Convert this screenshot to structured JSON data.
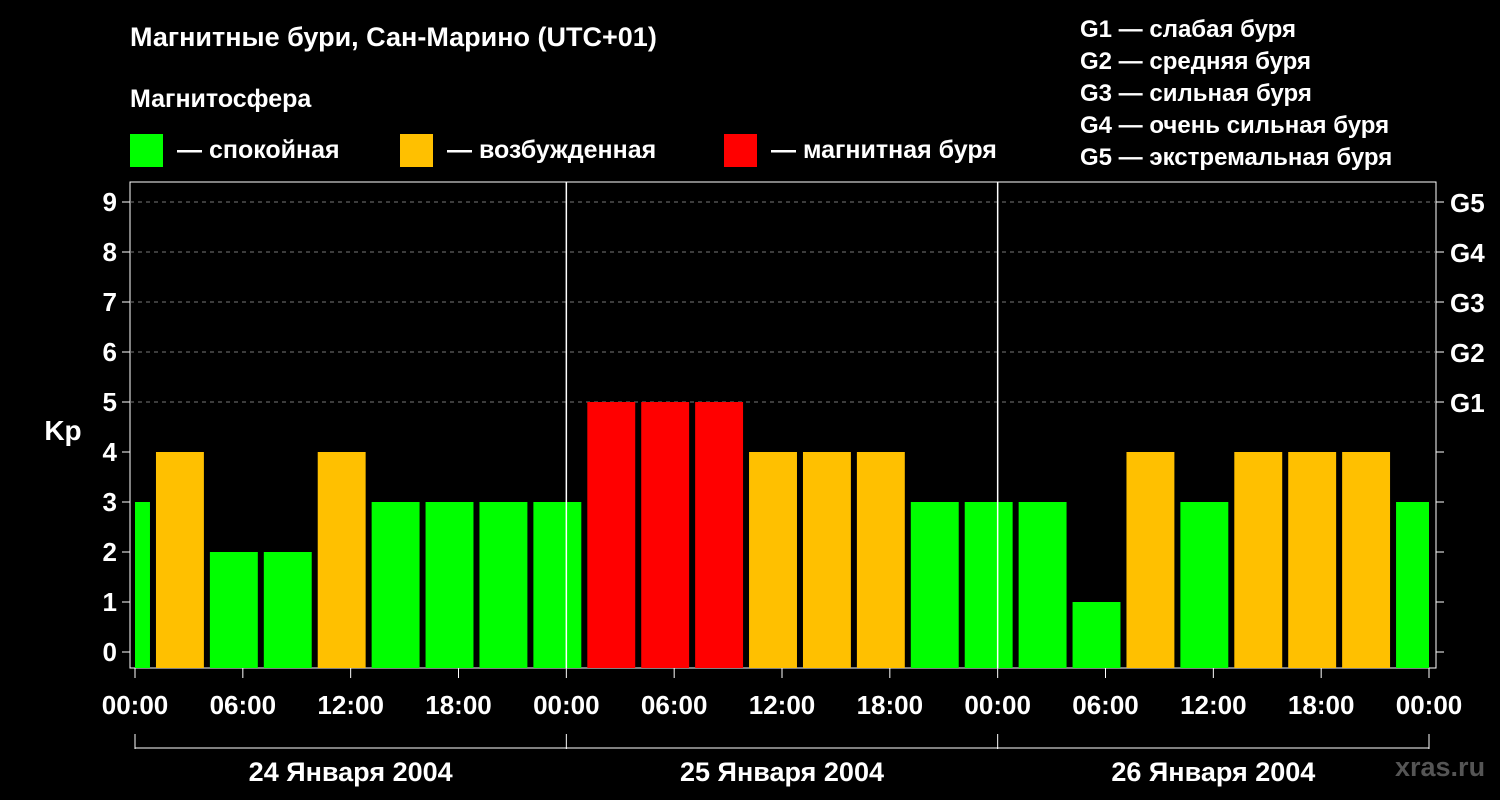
{
  "title": "Магнитные бури, Сан-Марино (UTC+01)",
  "subtitle": "Магнитосфера",
  "legend": [
    {
      "label": "— спокойная",
      "color": "#00ff00"
    },
    {
      "label": "— возбужденная",
      "color": "#ffc000"
    },
    {
      "label": "— магнитная буря",
      "color": "#ff0000"
    }
  ],
  "g_scale": [
    "G1 — слабая буря",
    "G2 — средняя буря",
    "G3 — сильная буря",
    "G4 — очень сильная буря",
    "G5 — экстремальная буря"
  ],
  "watermark": "xras.ru",
  "chart_data": {
    "type": "bar",
    "ylabel": "Kp",
    "ylim": [
      0,
      9
    ],
    "yticks": [
      0,
      1,
      2,
      3,
      4,
      5,
      6,
      7,
      8,
      9
    ],
    "right_axis": [
      {
        "kp": 5,
        "label": "G1"
      },
      {
        "kp": 6,
        "label": "G2"
      },
      {
        "kp": 7,
        "label": "G3"
      },
      {
        "kp": 8,
        "label": "G4"
      },
      {
        "kp": 9,
        "label": "G5"
      }
    ],
    "x_tick_labels": [
      "00:00",
      "06:00",
      "12:00",
      "18:00",
      "00:00",
      "06:00",
      "12:00",
      "18:00",
      "00:00",
      "06:00",
      "12:00",
      "18:00",
      "00:00"
    ],
    "days": [
      "24 Января 2004",
      "25 Января 2004",
      "26 Января 2004"
    ],
    "grid": true,
    "bar_interval_hours": 3,
    "first_bar_start_hour": -2,
    "values": [
      3,
      4,
      2,
      2,
      4,
      3,
      3,
      3,
      3,
      5,
      5,
      5,
      4,
      4,
      4,
      3,
      3,
      3,
      1,
      4,
      3,
      4,
      4,
      4,
      3
    ],
    "levels": [
      "quiet",
      "unsettled",
      "quiet",
      "quiet",
      "unsettled",
      "quiet",
      "quiet",
      "quiet",
      "quiet",
      "storm",
      "storm",
      "storm",
      "unsettled",
      "unsettled",
      "unsettled",
      "quiet",
      "quiet",
      "quiet",
      "quiet",
      "unsettled",
      "quiet",
      "unsettled",
      "unsettled",
      "unsettled",
      "quiet"
    ],
    "colors": {
      "quiet": "#00ff00",
      "unsettled": "#ffc000",
      "storm": "#ff0000"
    }
  }
}
